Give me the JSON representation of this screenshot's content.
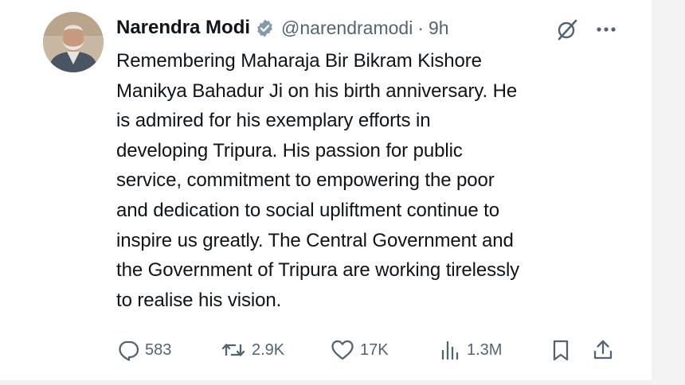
{
  "tweet": {
    "author_name": "Narendra Modi",
    "handle": "@narendramodi",
    "separator": "·",
    "time": "9h",
    "body": "Remembering Maharaja Bir Bikram Kishore\nManikya Bahadur Ji on his birth anniversary. He\nis admired for his exemplary efforts in\ndeveloping Tripura. His passion for public\nservice, commitment to empowering the poor\nand dedication to social upliftment continue to\ninspire us greatly. The Central Government and\nthe Government of Tripura are working tirelessly\nto realise his vision."
  },
  "actions": {
    "replies": "583",
    "reposts": "2.9K",
    "likes": "17K",
    "views": "1.3M"
  },
  "icons": {
    "verified": "verified-badge-icon",
    "grok": "grok-icon",
    "more": "more-options-icon",
    "reply": "reply-icon",
    "repost": "repost-icon",
    "like": "heart-icon",
    "views": "views-icon",
    "bookmark": "bookmark-icon",
    "share": "share-icon"
  },
  "colors": {
    "text": "#0f1419",
    "secondary": "#536471",
    "verified": "#829aab"
  }
}
